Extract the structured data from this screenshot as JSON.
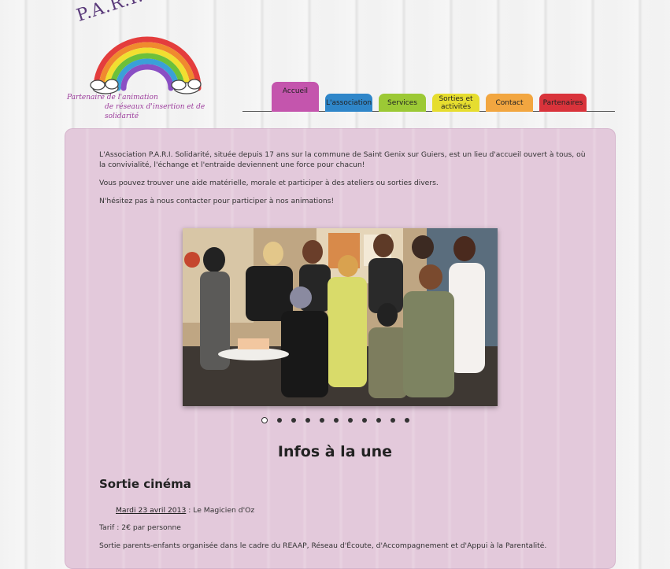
{
  "logo": {
    "title": "P.A.R.I. Solidarité",
    "tagline_line1": "Partenaire de l'animation",
    "tagline_line2": "de réseaux d'insertion et de solidarité"
  },
  "nav": {
    "tabs": [
      {
        "label": "Accueil",
        "color": "#c455ad"
      },
      {
        "label": "L'association",
        "color": "#2f86c9"
      },
      {
        "label": "Services",
        "color": "#9cc935"
      },
      {
        "label": "Sorties et activités",
        "color": "#e6dd2f"
      },
      {
        "label": "Contact",
        "color": "#f2a640"
      },
      {
        "label": "Partenaires",
        "color": "#d9333b"
      }
    ]
  },
  "intro": {
    "p1": "L'Association P.A.R.I. Solidarité, située depuis 17 ans sur la commune de Saint Genix sur Guiers, est un lieu d'accueil ouvert à tous, où la convivialité, l'échange et l'entraide deviennent une force pour chacun!",
    "p2": "Vous pouvez trouver une aide matérielle, morale et participer à des ateliers ou sorties divers.",
    "p3": "N'hésitez pas à nous contacter pour participer à nos animations!"
  },
  "slideshow": {
    "slide_count": 11,
    "active_index": 0
  },
  "news": {
    "section_title": "Infos à la une",
    "item_title": "Sortie cinéma",
    "date_link": "Mardi 23 avril 2013",
    "date_rest": " : Le Magicien d'Oz",
    "price": "Tarif : 2€ par personne",
    "description": "Sortie parents-enfants organisée dans le cadre du REAAP, Réseau d'Écoute, d'Accompagnement et d'Appui à la Parentalité."
  }
}
